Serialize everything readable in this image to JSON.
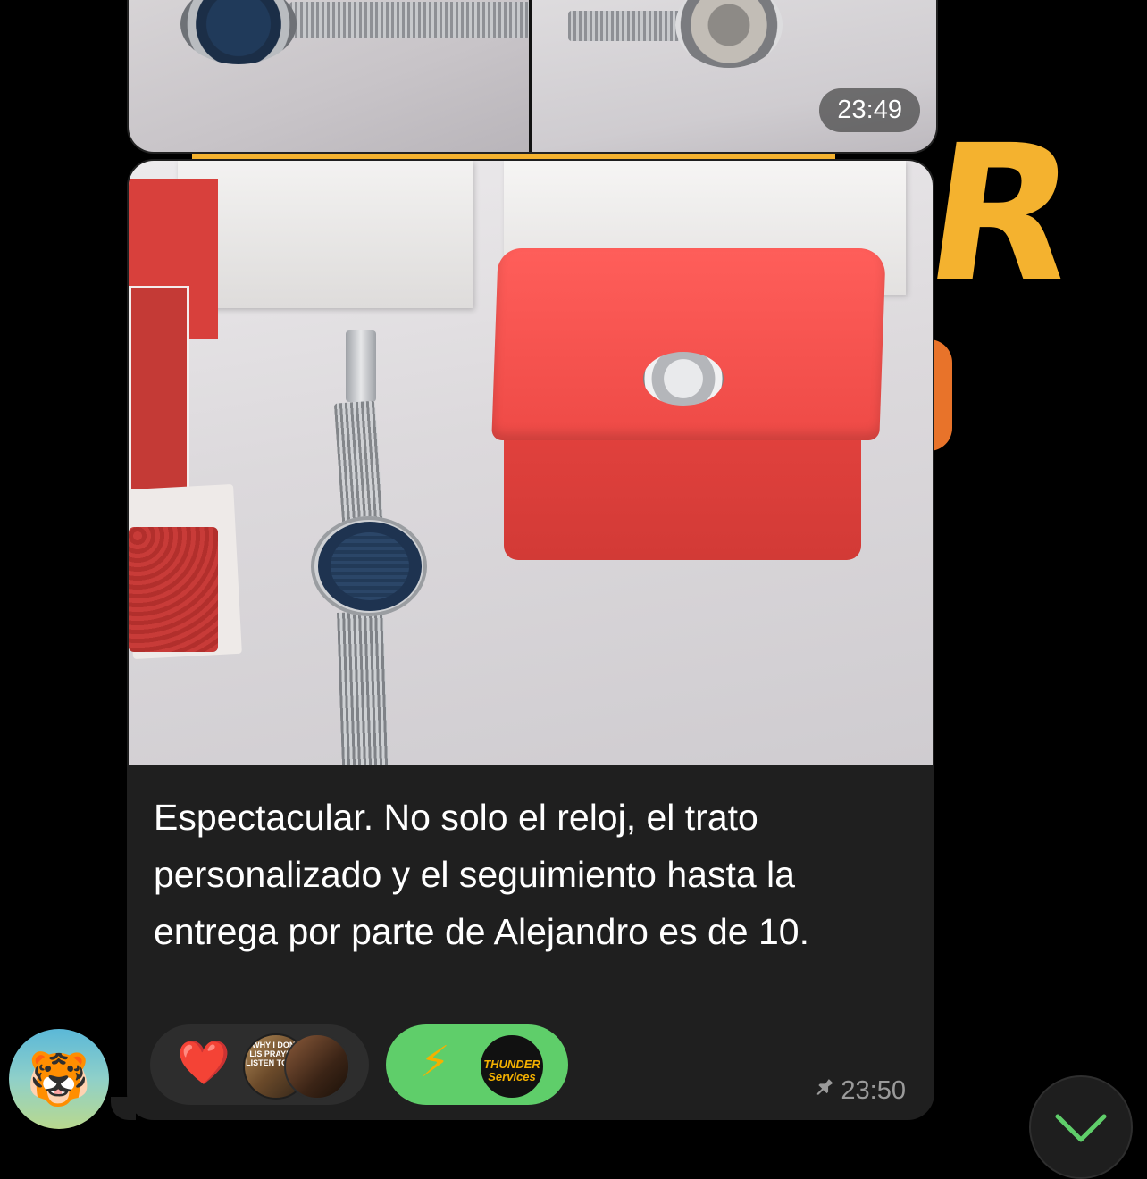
{
  "top_message": {
    "time": "23:49"
  },
  "message": {
    "caption": "Espectacular. No solo el reloj, el trato personalizado y el seguimiento hasta la entrega por parte de Alejandro es de 10.",
    "time": "23:50",
    "pinned": true,
    "reactions": [
      {
        "emoji": "❤️",
        "avatar_text": "WHY I DONT LIS PRAYERS LISTEN TO TOP"
      },
      {
        "emoji": "⚡",
        "avatar_text": "THUNDER Services",
        "selected": true
      }
    ]
  },
  "colors": {
    "background": "#000000",
    "bubble": "#1f1f1f",
    "reaction_selected": "#5fce6a",
    "reaction_default": "#2d2d2d",
    "meta_text": "#9a9a9a"
  },
  "sender": {
    "avatar_emoji": "🐯"
  },
  "icons": {
    "pin": "pin-icon",
    "scroll": "chevron-down-icon"
  }
}
